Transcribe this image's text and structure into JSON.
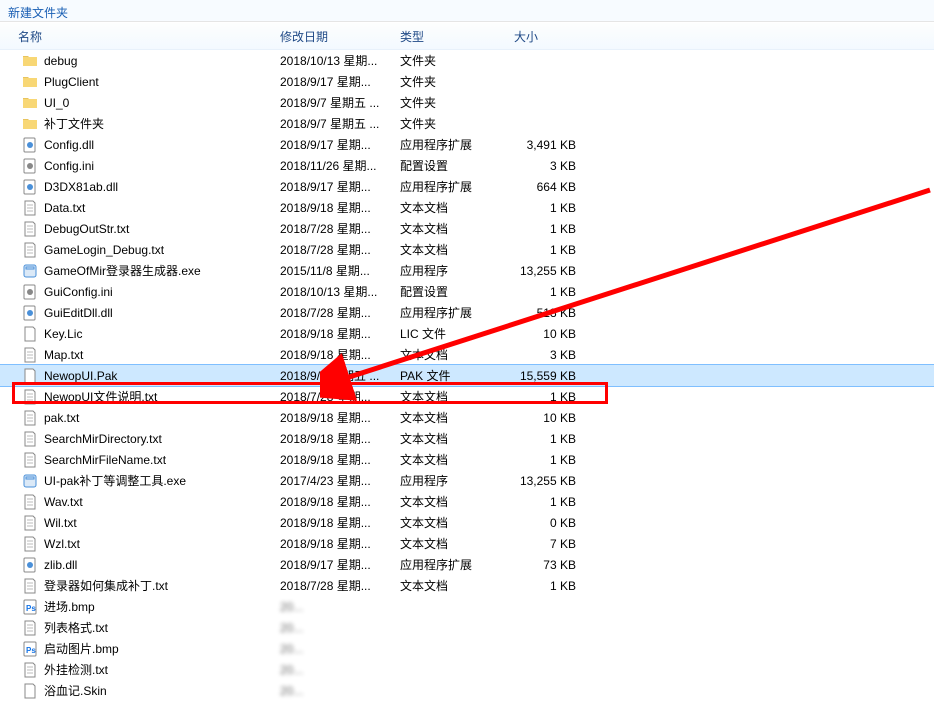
{
  "breadcrumb": "新建文件夹",
  "columns": {
    "name": "名称",
    "date": "修改日期",
    "type": "类型",
    "size": "大小"
  },
  "files": [
    {
      "icon": "folder",
      "name": "debug",
      "date": "2018/10/13 星期...",
      "type": "文件夹",
      "size": ""
    },
    {
      "icon": "folder",
      "name": "PlugClient",
      "date": "2018/9/17 星期...",
      "type": "文件夹",
      "size": ""
    },
    {
      "icon": "folder",
      "name": "UI_0",
      "date": "2018/9/7 星期五 ...",
      "type": "文件夹",
      "size": ""
    },
    {
      "icon": "folder",
      "name": "补丁文件夹",
      "date": "2018/9/7 星期五 ...",
      "type": "文件夹",
      "size": ""
    },
    {
      "icon": "dll",
      "name": "Config.dll",
      "date": "2018/9/17 星期...",
      "type": "应用程序扩展",
      "size": "3,491 KB"
    },
    {
      "icon": "ini",
      "name": "Config.ini",
      "date": "2018/11/26 星期...",
      "type": "配置设置",
      "size": "3 KB"
    },
    {
      "icon": "dll",
      "name": "D3DX81ab.dll",
      "date": "2018/9/17 星期...",
      "type": "应用程序扩展",
      "size": "664 KB"
    },
    {
      "icon": "txt",
      "name": "Data.txt",
      "date": "2018/9/18 星期...",
      "type": "文本文档",
      "size": "1 KB"
    },
    {
      "icon": "txt",
      "name": "DebugOutStr.txt",
      "date": "2018/7/28 星期...",
      "type": "文本文档",
      "size": "1 KB"
    },
    {
      "icon": "txt",
      "name": "GameLogin_Debug.txt",
      "date": "2018/7/28 星期...",
      "type": "文本文档",
      "size": "1 KB"
    },
    {
      "icon": "exe",
      "name": "GameOfMir登录器生成器.exe",
      "date": "2015/11/8 星期...",
      "type": "应用程序",
      "size": "13,255 KB"
    },
    {
      "icon": "ini",
      "name": "GuiConfig.ini",
      "date": "2018/10/13 星期...",
      "type": "配置设置",
      "size": "1 KB"
    },
    {
      "icon": "dll",
      "name": "GuiEditDll.dll",
      "date": "2018/7/28 星期...",
      "type": "应用程序扩展",
      "size": "513 KB"
    },
    {
      "icon": "file",
      "name": "Key.Lic",
      "date": "2018/9/18 星期...",
      "type": "LIC 文件",
      "size": "10 KB"
    },
    {
      "icon": "txt",
      "name": "Map.txt",
      "date": "2018/9/18 星期...",
      "type": "文本文档",
      "size": "3 KB"
    },
    {
      "icon": "file",
      "name": "NewopUI.Pak",
      "date": "2018/9/7 星期五 ...",
      "type": "PAK 文件",
      "size": "15,559 KB",
      "selected": true
    },
    {
      "icon": "txt",
      "name": "NewopUI文件说明.txt",
      "date": "2018/7/28 星期...",
      "type": "文本文档",
      "size": "1 KB"
    },
    {
      "icon": "txt",
      "name": "pak.txt",
      "date": "2018/9/18 星期...",
      "type": "文本文档",
      "size": "10 KB"
    },
    {
      "icon": "txt",
      "name": "SearchMirDirectory.txt",
      "date": "2018/9/18 星期...",
      "type": "文本文档",
      "size": "1 KB"
    },
    {
      "icon": "txt",
      "name": "SearchMirFileName.txt",
      "date": "2018/9/18 星期...",
      "type": "文本文档",
      "size": "1 KB"
    },
    {
      "icon": "exe",
      "name": "UI-pak补丁等调整工具.exe",
      "date": "2017/4/23 星期...",
      "type": "应用程序",
      "size": "13,255 KB"
    },
    {
      "icon": "txt",
      "name": "Wav.txt",
      "date": "2018/9/18 星期...",
      "type": "文本文档",
      "size": "1 KB"
    },
    {
      "icon": "txt",
      "name": "Wil.txt",
      "date": "2018/9/18 星期...",
      "type": "文本文档",
      "size": "0 KB"
    },
    {
      "icon": "txt",
      "name": "Wzl.txt",
      "date": "2018/9/18 星期...",
      "type": "文本文档",
      "size": "7 KB"
    },
    {
      "icon": "dll",
      "name": "zlib.dll",
      "date": "2018/9/17 星期...",
      "type": "应用程序扩展",
      "size": "73 KB"
    },
    {
      "icon": "txt",
      "name": "登录器如何集成补丁.txt",
      "date": "2018/7/28 星期...",
      "type": "文本文档",
      "size": "1 KB"
    },
    {
      "icon": "bmp",
      "name": "进场.bmp",
      "date": "20...",
      "type": "",
      "size": "",
      "blurred": true
    },
    {
      "icon": "txt",
      "name": "列表格式.txt",
      "date": "20...",
      "type": "",
      "size": "",
      "blurred": true
    },
    {
      "icon": "bmp",
      "name": "启动图片.bmp",
      "date": "20...",
      "type": "",
      "size": "",
      "blurred": true
    },
    {
      "icon": "txt",
      "name": "外挂检测.txt",
      "date": "20...",
      "type": "",
      "size": "",
      "blurred": true
    },
    {
      "icon": "file",
      "name": "浴血记.Skin",
      "date": "20...",
      "type": "",
      "size": "",
      "blurred": true
    }
  ]
}
